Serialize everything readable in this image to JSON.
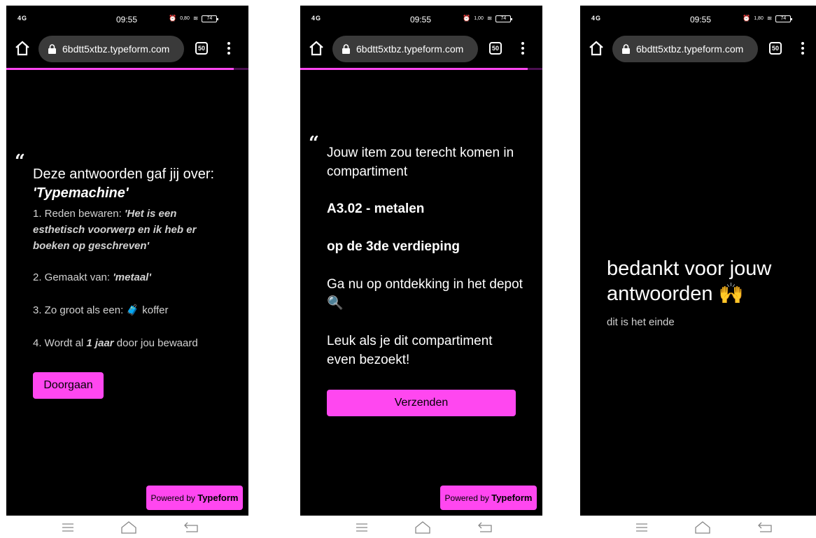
{
  "browser": {
    "time": "09:55",
    "network": "4G",
    "battery": "74",
    "url": "6bdtt5xtbz.typeform.com",
    "tab_count": "50",
    "speeds": [
      "0,80",
      "1,00",
      "1,80"
    ],
    "speed_unit": "KB/s"
  },
  "progress": [
    0.94,
    0.94,
    0.0
  ],
  "accent_color": "#ff47f0",
  "screen1": {
    "title": "Deze antwoorden gaf jij over:",
    "subject": "'Typemachine'",
    "reason_label": "1. Reden bewaren: ",
    "reason_value": "'Het is een esthetisch voorwerp en ik heb er boeken op geschreven'",
    "material_label": "2. Gemaakt van: ",
    "material_value": "'metaal'",
    "size_label": "3. Zo groot als een: ",
    "size_icon": "suitcase-emoji",
    "size_value": " koffer",
    "kept_prefix": "4. Wordt al ",
    "kept_value": "1 jaar",
    "kept_suffix": " door jou bewaard",
    "button": "Doorgaan"
  },
  "screen2": {
    "intro": "Jouw item zou terecht komen in compartiment",
    "compartment": "A3.02 - metalen",
    "floor": "op de 3de verdieping",
    "explore": "Ga nu op ontdekking in het depot",
    "explore_icon": "magnifier-emoji",
    "visit": "Leuk als je dit compartiment even bezoekt!",
    "button": "Verzenden"
  },
  "screen3": {
    "title": "bedankt voor jouw antwoorden",
    "title_icon": "raised-hands-emoji",
    "subtitle": "dit is het einde"
  },
  "powered": {
    "prefix": "Powered by ",
    "brand": "Typeform"
  }
}
